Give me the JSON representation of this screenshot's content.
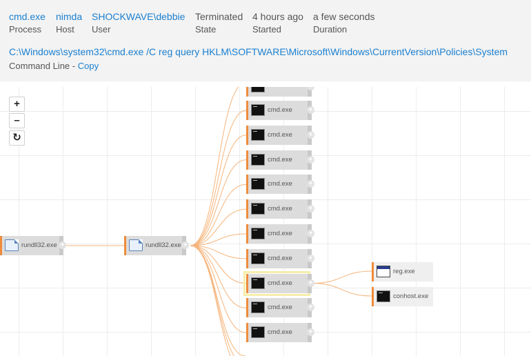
{
  "process": {
    "name": "cmd.exe",
    "host": "nimda",
    "user": "SHOCKWAVE\\debbie",
    "state": "Terminated",
    "started": "4 hours ago",
    "duration": "a few seconds"
  },
  "labels": {
    "process": "Process",
    "host": "Host",
    "user": "User",
    "state": "State",
    "started": "Started",
    "duration": "Duration",
    "command_line": "Command Line - ",
    "copy": "Copy"
  },
  "command_line": "C:\\Windows\\system32\\cmd.exe /C reg query HKLM\\SOFTWARE\\Microsoft\\Windows\\CurrentVersion\\Policies\\System",
  "zoom_controls": {
    "zoom_in": "+",
    "zoom_out": "–",
    "reset": "↻"
  },
  "graph": {
    "root": {
      "label": "rundll32.exe",
      "icon": "document-icon"
    },
    "parent": {
      "label": "rundll32.exe",
      "icon": "document-icon"
    },
    "siblings": [
      {
        "label": "cmd.exe",
        "icon": "console-icon"
      },
      {
        "label": "cmd.exe",
        "icon": "console-icon"
      },
      {
        "label": "cmd.exe",
        "icon": "console-icon"
      },
      {
        "label": "cmd.exe",
        "icon": "console-icon"
      },
      {
        "label": "cmd.exe",
        "icon": "console-icon"
      },
      {
        "label": "cmd.exe",
        "icon": "console-icon"
      },
      {
        "label": "cmd.exe",
        "icon": "console-icon"
      },
      {
        "label": "cmd.exe",
        "icon": "console-icon",
        "selected": true
      },
      {
        "label": "cmd.exe",
        "icon": "console-icon"
      },
      {
        "label": "cmd.exe",
        "icon": "console-icon"
      }
    ],
    "children": [
      {
        "label": "reg.exe",
        "icon": "registry-window-icon"
      },
      {
        "label": "conhost.exe",
        "icon": "console-icon"
      }
    ],
    "colors": {
      "edge": "#f6b47a",
      "accent": "#ef8b3a",
      "selected": "#f6eeaa",
      "link": "#1a7fd0"
    }
  }
}
